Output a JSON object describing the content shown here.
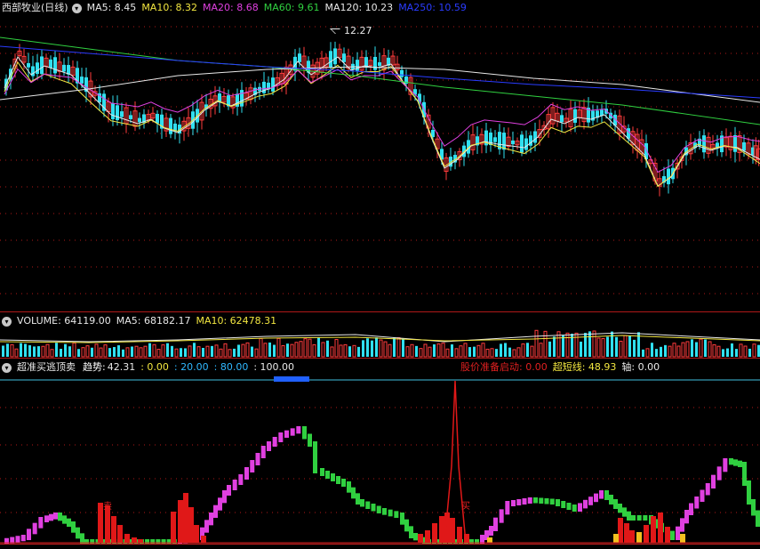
{
  "main_pane": {
    "stock_name": "西部牧业(日线)",
    "legend": [
      {
        "label": "MA5: 8.45",
        "color": "#e8e8e8"
      },
      {
        "label": "MA10: 8.32",
        "color": "#f2e640"
      },
      {
        "label": "MA20: 8.68",
        "color": "#e040e0"
      },
      {
        "label": "MA60: 9.61",
        "color": "#30d040"
      },
      {
        "label": "MA120: 10.23",
        "color": "#e8e8e8"
      },
      {
        "label": "MA250: 10.59",
        "color": "#2a3cff"
      }
    ],
    "high_marker": "12.27"
  },
  "volume_pane": {
    "legend": [
      {
        "label": "VOLUME: 64119.00",
        "color": "#e8e8e8"
      },
      {
        "label": "MA5: 68182.17",
        "color": "#e8e8e8"
      },
      {
        "label": "MA10: 62478.31",
        "color": "#f2e640"
      }
    ]
  },
  "indicator_pane": {
    "title": "超准买逃顶卖",
    "legend": [
      {
        "label": "趋势:",
        "color": "#ffffff"
      },
      {
        "label": "42.31",
        "color": "#e8e8e8"
      },
      {
        "label": ": 0.00",
        "color": "#f2e640"
      },
      {
        "label": ": 20.00",
        "color": "#30b8ff"
      },
      {
        "label": ": 80.00",
        "color": "#30b8ff"
      },
      {
        "label": ": 100.00",
        "color": "#e8e8e8"
      }
    ],
    "right_legend": [
      {
        "label": "股价准备启动: 0.00",
        "color": "#e02020"
      },
      {
        "label": "超短线: 48.93",
        "color": "#f2e640"
      },
      {
        "label": "轴: 0.00",
        "color": "#e8e8e8"
      }
    ],
    "signal_sell": "卖",
    "signal_buy": "买"
  },
  "colors": {
    "up": "#ff3c3c",
    "down": "#30e0f0",
    "grid": "#b01818",
    "background": "#000000"
  }
}
